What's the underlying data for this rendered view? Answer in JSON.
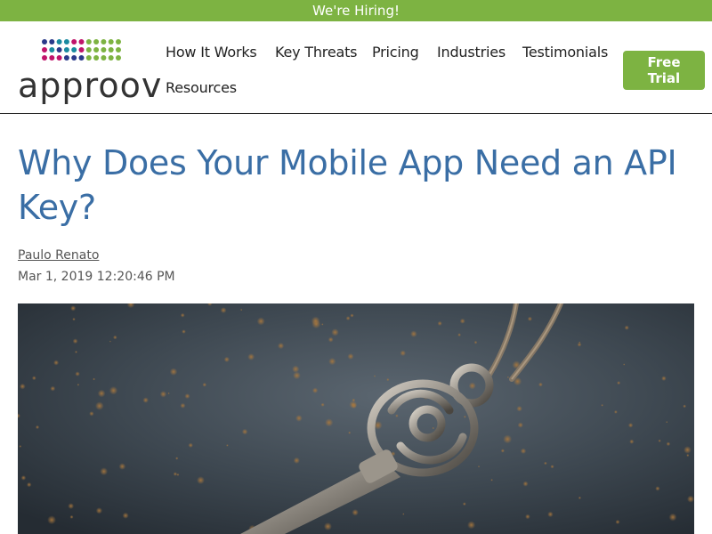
{
  "banner": {
    "text": "We're Hiring!"
  },
  "logo": {
    "text": "approov"
  },
  "nav": {
    "items": [
      "How It Works",
      "Key Threats",
      "Pricing",
      "Industries",
      "Testimonials",
      "Resources"
    ],
    "cta_line1": "Free",
    "cta_line2": "Trial"
  },
  "article": {
    "title": "Why Does Your Mobile App Need an API Key?",
    "author": "Paulo Renato",
    "date": "Mar 1, 2019 12:20:46 PM",
    "image_alt": "Ornate key on chain"
  },
  "colors": {
    "brand_green": "#7db342",
    "title_blue": "#3a6ea5"
  },
  "icons": {
    "logo_mark": "approov-dots-logo"
  }
}
